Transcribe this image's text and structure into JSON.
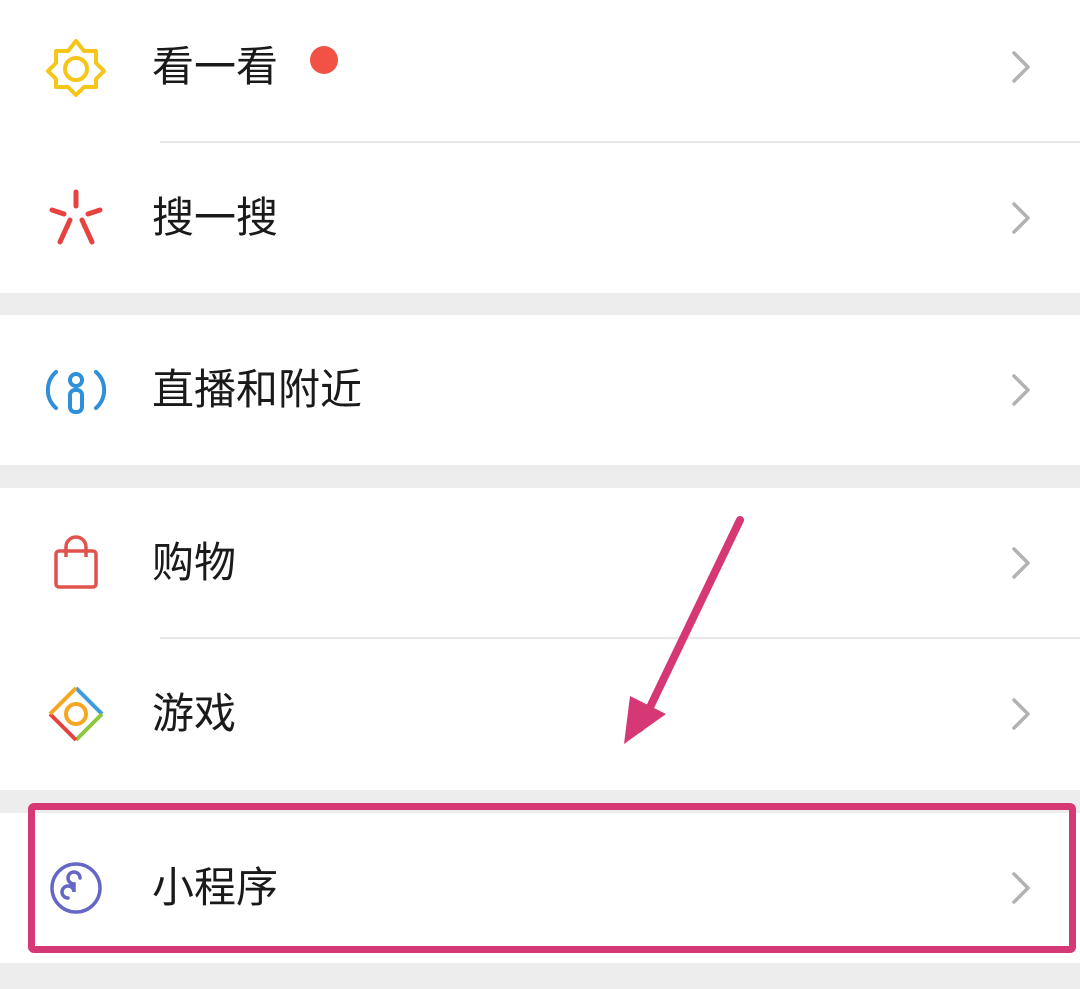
{
  "menu": {
    "items": [
      {
        "label": "看一看",
        "icon": "star-flower-icon",
        "badge": "red-dot"
      },
      {
        "label": "搜一搜",
        "icon": "search-sparkle-icon"
      },
      {
        "label": "直播和附近",
        "icon": "live-nearby-icon"
      },
      {
        "label": "购物",
        "icon": "shopping-bag-icon"
      },
      {
        "label": "游戏",
        "icon": "game-diamond-icon"
      },
      {
        "label": "小程序",
        "icon": "mini-program-icon"
      }
    ]
  },
  "colors": {
    "background": "#ededed",
    "row_background": "#ffffff",
    "text": "#1a1a1a",
    "chevron": "#b2b2b2",
    "badge": "#f25246",
    "annotation": "#d63775",
    "look_icon": "#f5c518",
    "search_icon": "#e64340",
    "live_icon": "#2f8fd8",
    "shop_icon": "#e0524c",
    "mini_program_icon": "#6467c5"
  }
}
